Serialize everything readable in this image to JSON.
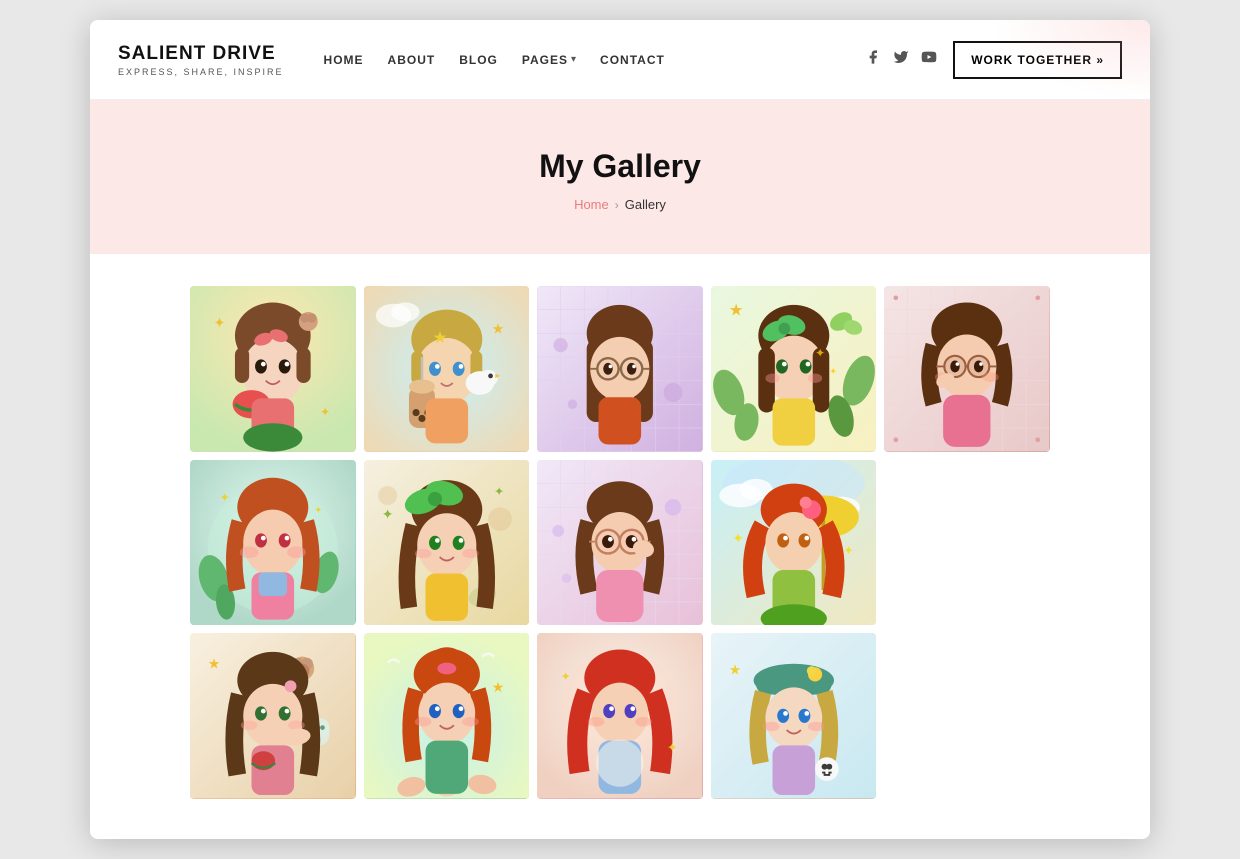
{
  "site": {
    "logo_title": "SALIENT DRIVE",
    "logo_subtitle": "EXPRESS, SHARE, INSPIRE"
  },
  "nav": {
    "items": [
      {
        "label": "HOME",
        "id": "home"
      },
      {
        "label": "ABOUT",
        "id": "about"
      },
      {
        "label": "BLOG",
        "id": "blog"
      },
      {
        "label": "PAGES",
        "id": "pages",
        "has_dropdown": true
      },
      {
        "label": "CONTACT",
        "id": "contact"
      }
    ],
    "work_together_label": "WORK TOGETHER »"
  },
  "social": {
    "facebook": "f",
    "twitter": "t",
    "youtube": "▶"
  },
  "hero": {
    "page_title": "My Gallery",
    "breadcrumb_home": "Home",
    "breadcrumb_sep": "›",
    "breadcrumb_current": "Gallery"
  },
  "gallery": {
    "items": [
      {
        "id": 1,
        "alt": "Anime girl with watermelon bag"
      },
      {
        "id": 2,
        "alt": "Anime girl with bubble tea and bird"
      },
      {
        "id": 3,
        "alt": "Anime girl with glasses"
      },
      {
        "id": 4,
        "alt": "Anime girl with green bow and plants"
      },
      {
        "id": 5,
        "alt": "Anime girl in pink dress"
      },
      {
        "id": 6,
        "alt": "Anime girl with flowers"
      },
      {
        "id": 7,
        "alt": "Anime girl with green bow yellow sweater"
      },
      {
        "id": 8,
        "alt": "Anime girl with glasses pink"
      },
      {
        "id": 9,
        "alt": "Anime girl with umbrella"
      },
      {
        "id": 10,
        "alt": "Anime girl with brown hair"
      },
      {
        "id": 11,
        "alt": "Anime girl with orange hair"
      },
      {
        "id": 12,
        "alt": "Anime girl with red hair"
      },
      {
        "id": 13,
        "alt": "Anime girl with teal hat"
      }
    ]
  }
}
